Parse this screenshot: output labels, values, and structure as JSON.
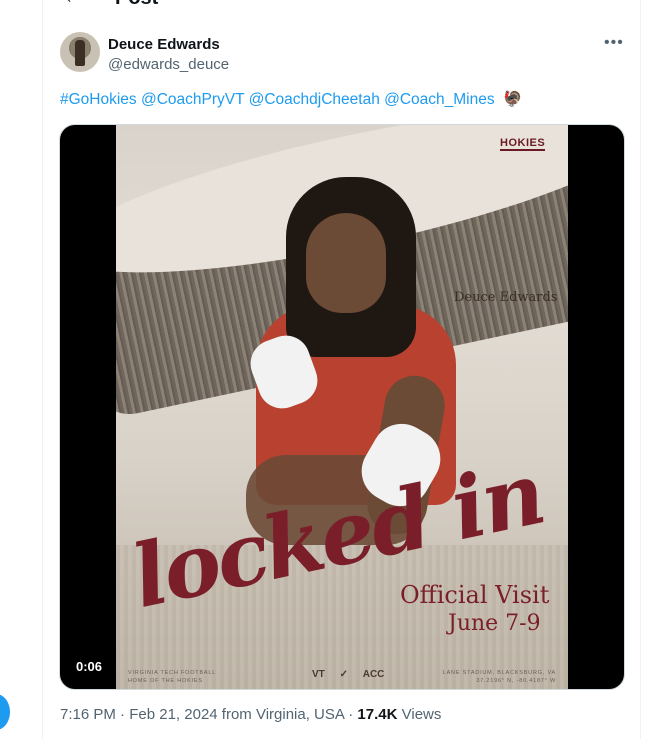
{
  "header": {
    "title": "Post"
  },
  "author": {
    "display_name": "Deuce Edwards",
    "handle": "@edwards_deuce"
  },
  "tweet": {
    "text": "#GoHokies @CoachPryVT @CoachdjCheetah @Coach_Mines",
    "emoji": "🦃"
  },
  "media": {
    "video_time": "0:06",
    "poster": {
      "logo": "HOKIES",
      "name": "Deuce Edwards",
      "headline": "locked in",
      "event": "Official Visit",
      "dates": "June 7-9",
      "footer_left_1": "VIRGINIA TECH FOOTBALL",
      "footer_left_2": "HOME OF THE HOKIES",
      "footer_right_1": "LANE STADIUM, BLACKSBURG, VA",
      "footer_right_2": "37.2196° N, -80.4187° W",
      "footer_logos": [
        "VT",
        "✓",
        "ACC"
      ]
    }
  },
  "meta": {
    "time": "7:16 PM",
    "date": "Feb 21, 2024",
    "location": "from Virginia, USA",
    "views_count": "17.4K",
    "views_label": "Views"
  },
  "icons": {
    "back": "arrow-left-icon",
    "more": "more-horizontal-icon"
  }
}
